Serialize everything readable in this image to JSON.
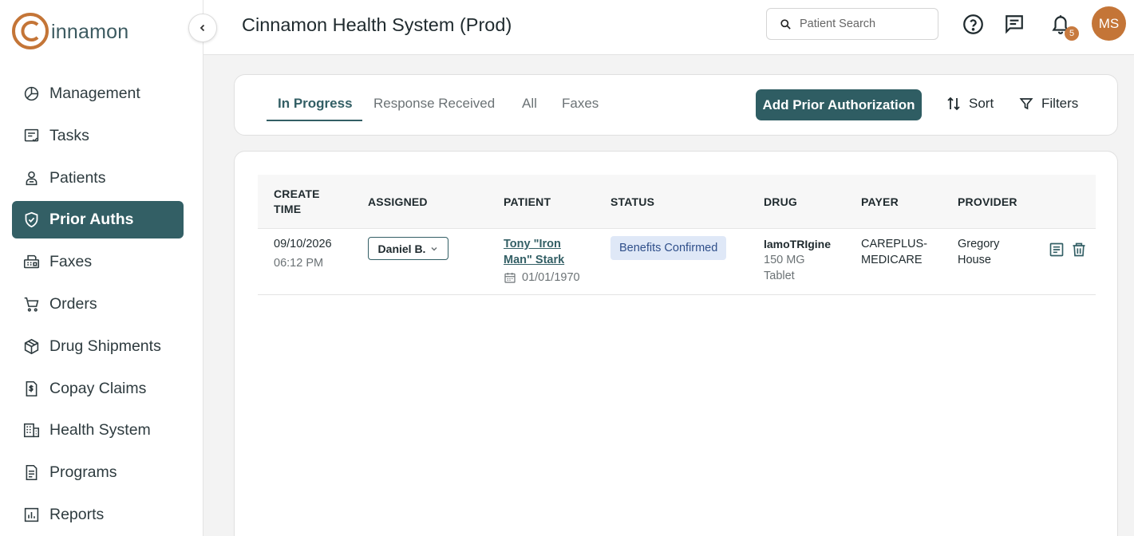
{
  "brand": {
    "logo_text": "innamon",
    "accent": "#c47537",
    "primary": "#335f65"
  },
  "header": {
    "title": "Cinnamon Health System (Prod)",
    "search_placeholder": "Patient Search",
    "notification_count": "5",
    "avatar_initials": "MS"
  },
  "sidebar": {
    "items": [
      {
        "label": "Management",
        "icon": "chart-pie-icon"
      },
      {
        "label": "Tasks",
        "icon": "task-list-icon"
      },
      {
        "label": "Patients",
        "icon": "patient-icon"
      },
      {
        "label": "Prior Auths",
        "icon": "shield-check-icon",
        "active": true
      },
      {
        "label": "Faxes",
        "icon": "fax-icon"
      },
      {
        "label": "Orders",
        "icon": "cart-icon"
      },
      {
        "label": "Drug Shipments",
        "icon": "box-icon"
      },
      {
        "label": "Copay Claims",
        "icon": "dollar-document-icon"
      },
      {
        "label": "Health System",
        "icon": "building-icon"
      },
      {
        "label": "Programs",
        "icon": "document-icon"
      },
      {
        "label": "Reports",
        "icon": "report-icon"
      }
    ]
  },
  "toolbar": {
    "tabs": [
      {
        "label": "In Progress",
        "active": true
      },
      {
        "label": "Response Received"
      },
      {
        "label": "All"
      },
      {
        "label": "Faxes"
      }
    ],
    "add_label": "Add Prior Authorization",
    "sort_label": "Sort",
    "filters_label": "Filters"
  },
  "table": {
    "columns": [
      "CREATE TIME",
      "ASSIGNED",
      "PATIENT",
      "STATUS",
      "DRUG",
      "PAYER",
      "PROVIDER"
    ],
    "column_lines": {
      "create_time": [
        "CREATE",
        "TIME"
      ]
    },
    "rows": [
      {
        "create_date": "09/10/2026",
        "create_time": "06:12 PM",
        "assigned": "Daniel B.",
        "patient_line1": "Tony \"Iron",
        "patient_line2": "Man\" Stark",
        "dob": "01/01/1970",
        "status": "Benefits Confirmed",
        "drug_name": "lamoTRIgine",
        "drug_dose": "150 MG",
        "drug_form": "Tablet",
        "payer_line1": "CAREPLUS-",
        "payer_line2": "MEDICARE",
        "provider_line1": "Gregory",
        "provider_line2": "House"
      }
    ]
  }
}
